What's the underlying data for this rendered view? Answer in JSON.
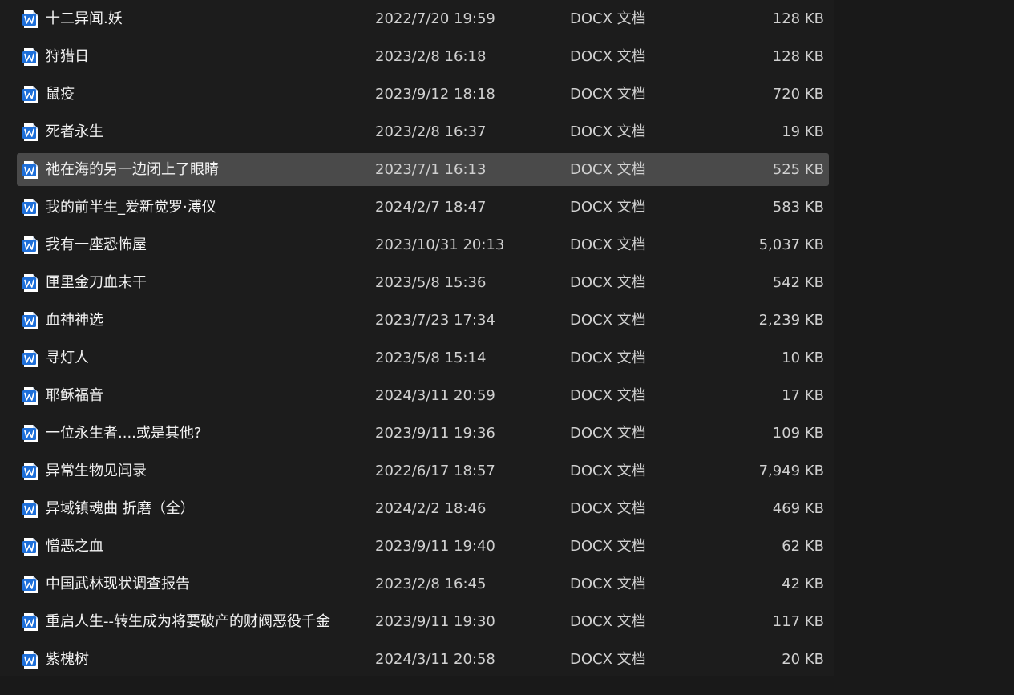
{
  "icon_color": "#1e6fd9",
  "selected_index": 4,
  "files": [
    {
      "name": "十二异闻.妖",
      "modified": "2022/7/20 19:59",
      "type": "DOCX 文档",
      "size": "128 KB",
      "icon": "word-doc-icon"
    },
    {
      "name": "狩猎日",
      "modified": "2023/2/8 16:18",
      "type": "DOCX 文档",
      "size": "128 KB",
      "icon": "word-doc-icon"
    },
    {
      "name": "鼠疫",
      "modified": "2023/9/12 18:18",
      "type": "DOCX 文档",
      "size": "720 KB",
      "icon": "word-doc-icon"
    },
    {
      "name": "死者永生",
      "modified": "2023/2/8 16:37",
      "type": "DOCX 文档",
      "size": "19 KB",
      "icon": "word-doc-icon"
    },
    {
      "name": "祂在海的另一边闭上了眼睛",
      "modified": "2023/7/1 16:13",
      "type": "DOCX 文档",
      "size": "525 KB",
      "icon": "word-doc-icon"
    },
    {
      "name": "我的前半生_爱新觉罗·溥仪",
      "modified": "2024/2/7 18:47",
      "type": "DOCX 文档",
      "size": "583 KB",
      "icon": "word-doc-icon"
    },
    {
      "name": "我有一座恐怖屋",
      "modified": "2023/10/31 20:13",
      "type": "DOCX 文档",
      "size": "5,037 KB",
      "icon": "word-doc-icon"
    },
    {
      "name": "匣里金刀血未干",
      "modified": "2023/5/8 15:36",
      "type": "DOCX 文档",
      "size": "542 KB",
      "icon": "word-doc-icon"
    },
    {
      "name": "血神神选",
      "modified": "2023/7/23 17:34",
      "type": "DOCX 文档",
      "size": "2,239 KB",
      "icon": "word-doc-icon"
    },
    {
      "name": "寻灯人",
      "modified": "2023/5/8 15:14",
      "type": "DOCX 文档",
      "size": "10 KB",
      "icon": "word-doc-icon"
    },
    {
      "name": "耶稣福音",
      "modified": "2024/3/11 20:59",
      "type": "DOCX 文档",
      "size": "17 KB",
      "icon": "word-doc-icon"
    },
    {
      "name": "一位永生者....或是其他?",
      "modified": "2023/9/11 19:36",
      "type": "DOCX 文档",
      "size": "109 KB",
      "icon": "word-doc-icon"
    },
    {
      "name": "异常生物见闻录",
      "modified": "2022/6/17 18:57",
      "type": "DOCX 文档",
      "size": "7,949 KB",
      "icon": "word-doc-icon"
    },
    {
      "name": "异域镇魂曲 折磨（全）",
      "modified": "2024/2/2 18:46",
      "type": "DOCX 文档",
      "size": "469 KB",
      "icon": "word-doc-icon"
    },
    {
      "name": "憎恶之血",
      "modified": "2023/9/11 19:40",
      "type": "DOCX 文档",
      "size": "62 KB",
      "icon": "word-doc-icon"
    },
    {
      "name": "中国武林现状调查报告",
      "modified": "2023/2/8 16:45",
      "type": "DOCX 文档",
      "size": "42 KB",
      "icon": "word-doc-icon"
    },
    {
      "name": "重启人生--转生成为将要破产的财阀恶役千金",
      "modified": "2023/9/11 19:30",
      "type": "DOCX 文档",
      "size": "117 KB",
      "icon": "word-doc-icon"
    },
    {
      "name": "紫槐树",
      "modified": "2024/3/11 20:58",
      "type": "DOCX 文档",
      "size": "20 KB",
      "icon": "word-doc-icon"
    }
  ]
}
